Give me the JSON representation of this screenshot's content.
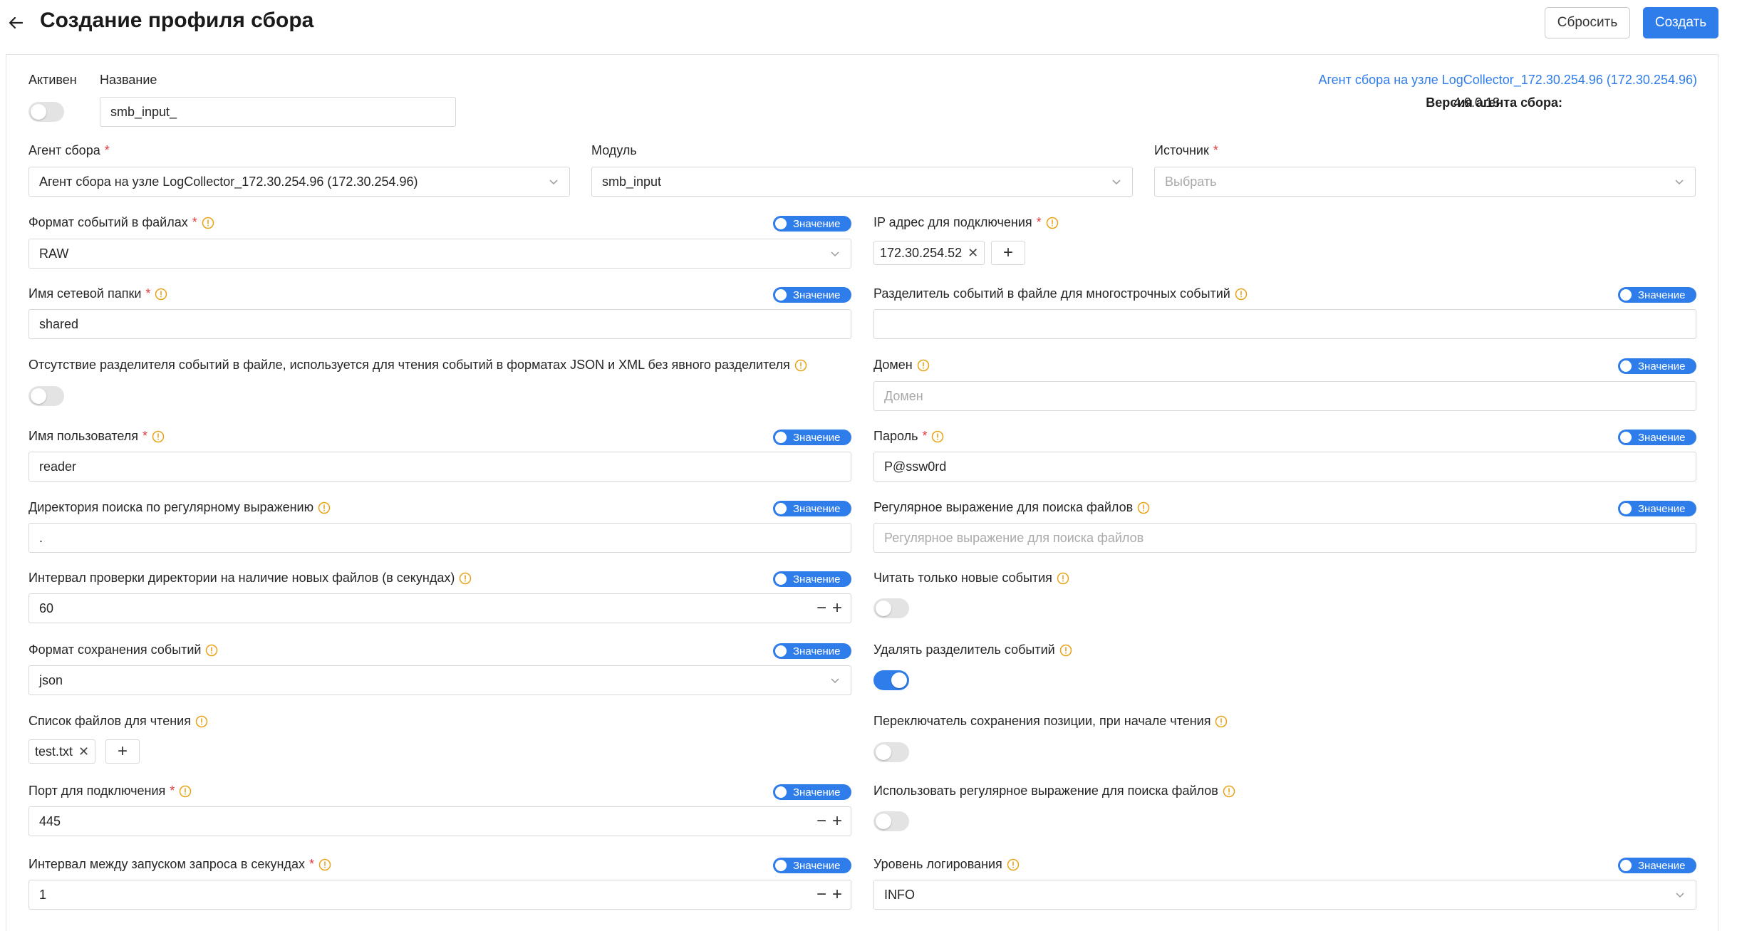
{
  "header": {
    "title": "Создание профиля сбора",
    "reset_label": "Сбросить",
    "create_label": "Создать"
  },
  "top": {
    "active_label": "Активен",
    "name_label": "Название",
    "name_value": "smb_input_",
    "agent_link": "Агент сбора на узле LogCollector_172.30.254.96 (172.30.254.96)",
    "agent_version_label": "Версия агента сбора:",
    "agent_version_value": "4.0.0.13"
  },
  "selects": {
    "agent_label": "Агент сбора",
    "agent_value": "Агент сбора на узле LogCollector_172.30.254.96 (172.30.254.96)",
    "module_label": "Модуль",
    "module_value": "smb_input",
    "source_label": "Источник",
    "source_placeholder": "Выбрать"
  },
  "value_pill": "Значение",
  "left": {
    "format_label": "Формат событий в файлах",
    "format_value": "RAW",
    "share_label": "Имя сетевой папки",
    "share_value": "shared",
    "no_delim_label": "Отсутствие разделителя событий в файле, используется для чтения событий в форматах JSON и XML без явного разделителя",
    "user_label": "Имя пользователя",
    "user_value": "reader",
    "dir_regex_label": "Директория поиска по регулярному выражению",
    "dir_regex_value": ".",
    "interval_label": "Интервал проверки директории на наличие новых файлов (в секундах)",
    "interval_value": "60",
    "save_format_label": "Формат сохранения событий",
    "save_format_value": "json",
    "files_label": "Список файлов для чтения",
    "files_tag": "test.txt",
    "port_label": "Порт для подключения",
    "port_value": "445",
    "query_interval_label": "Интервал между запуском запроса в секундах",
    "query_interval_value": "1"
  },
  "right": {
    "ip_label": "IP адрес для подключения",
    "ip_tag": "172.30.254.52",
    "multiline_label": "Разделитель событий в файле для многострочных событий",
    "domain_label": "Домен",
    "domain_placeholder": "Домен",
    "password_label": "Пароль",
    "password_value": "P@ssw0rd",
    "file_regex_label": "Регулярное выражение для поиска файлов",
    "file_regex_placeholder": "Регулярное выражение для поиска файлов",
    "only_new_label": "Читать только новые события",
    "remove_delim_label": "Удалять разделитель событий",
    "save_pos_label": "Переключатель сохранения позиции, при начале чтения",
    "use_regex_label": "Использовать регулярное выражение для поиска файлов",
    "log_level_label": "Уровень логирования",
    "log_level_value": "INFO"
  },
  "colors": {
    "accent": "#2f7dea",
    "required": "#e23b3b",
    "info": "#e8a317"
  }
}
